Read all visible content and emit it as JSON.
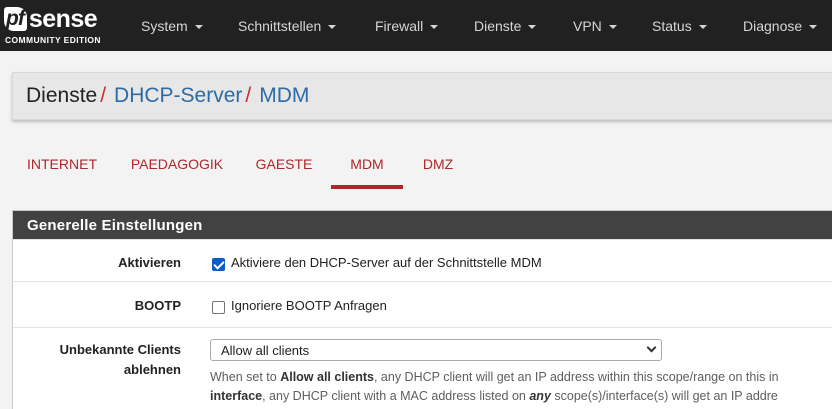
{
  "navbar": {
    "logo": {
      "pf": "pf",
      "sense": "sense",
      "edition": "COMMUNITY EDITION"
    },
    "items": [
      {
        "label": "System"
      },
      {
        "label": "Schnittstellen"
      },
      {
        "label": "Firewall"
      },
      {
        "label": "Dienste"
      },
      {
        "label": "VPN"
      },
      {
        "label": "Status"
      },
      {
        "label": "Diagnose"
      }
    ]
  },
  "breadcrumb": {
    "items": [
      "Dienste",
      "DHCP-Server",
      "MDM"
    ],
    "separator": "/"
  },
  "tabs": [
    {
      "label": "INTERNET",
      "active": false
    },
    {
      "label": "PAEDAGOGIK",
      "active": false
    },
    {
      "label": "GAESTE",
      "active": false
    },
    {
      "label": "MDM",
      "active": true
    },
    {
      "label": "DMZ",
      "active": false
    }
  ],
  "panel": {
    "title": "Generelle Einstellungen",
    "rows": {
      "enable": {
        "label": "Aktivieren",
        "checkbox_label": "Aktiviere den DHCP-Server auf der Schnittstelle MDM",
        "checked": true
      },
      "bootp": {
        "label": "BOOTP",
        "checkbox_label": "Ignoriere BOOTP Anfragen",
        "checked": false
      },
      "unknown_clients": {
        "label_line1": "Unbekannte Clients",
        "label_line2": "ablehnen",
        "select_value": "Allow all clients",
        "help_line1": {
          "t1": "When set to ",
          "b1": "Allow all clients",
          "t2": ", any DHCP client will get an IP address within this scope/range on this in"
        },
        "help_line2": {
          "b1": "interface",
          "t1": ", any DHCP client with a MAC address listed on ",
          "b2": "any",
          "t2": " scope(s)/interface(s) will get an IP addre"
        }
      }
    }
  },
  "colors": {
    "navbar_bg": "#212121",
    "accent_red": "#b0262b",
    "link_blue": "#2d6ba6",
    "panel_heading_bg": "#424242",
    "checkbox_blue": "#0b5cc8"
  }
}
